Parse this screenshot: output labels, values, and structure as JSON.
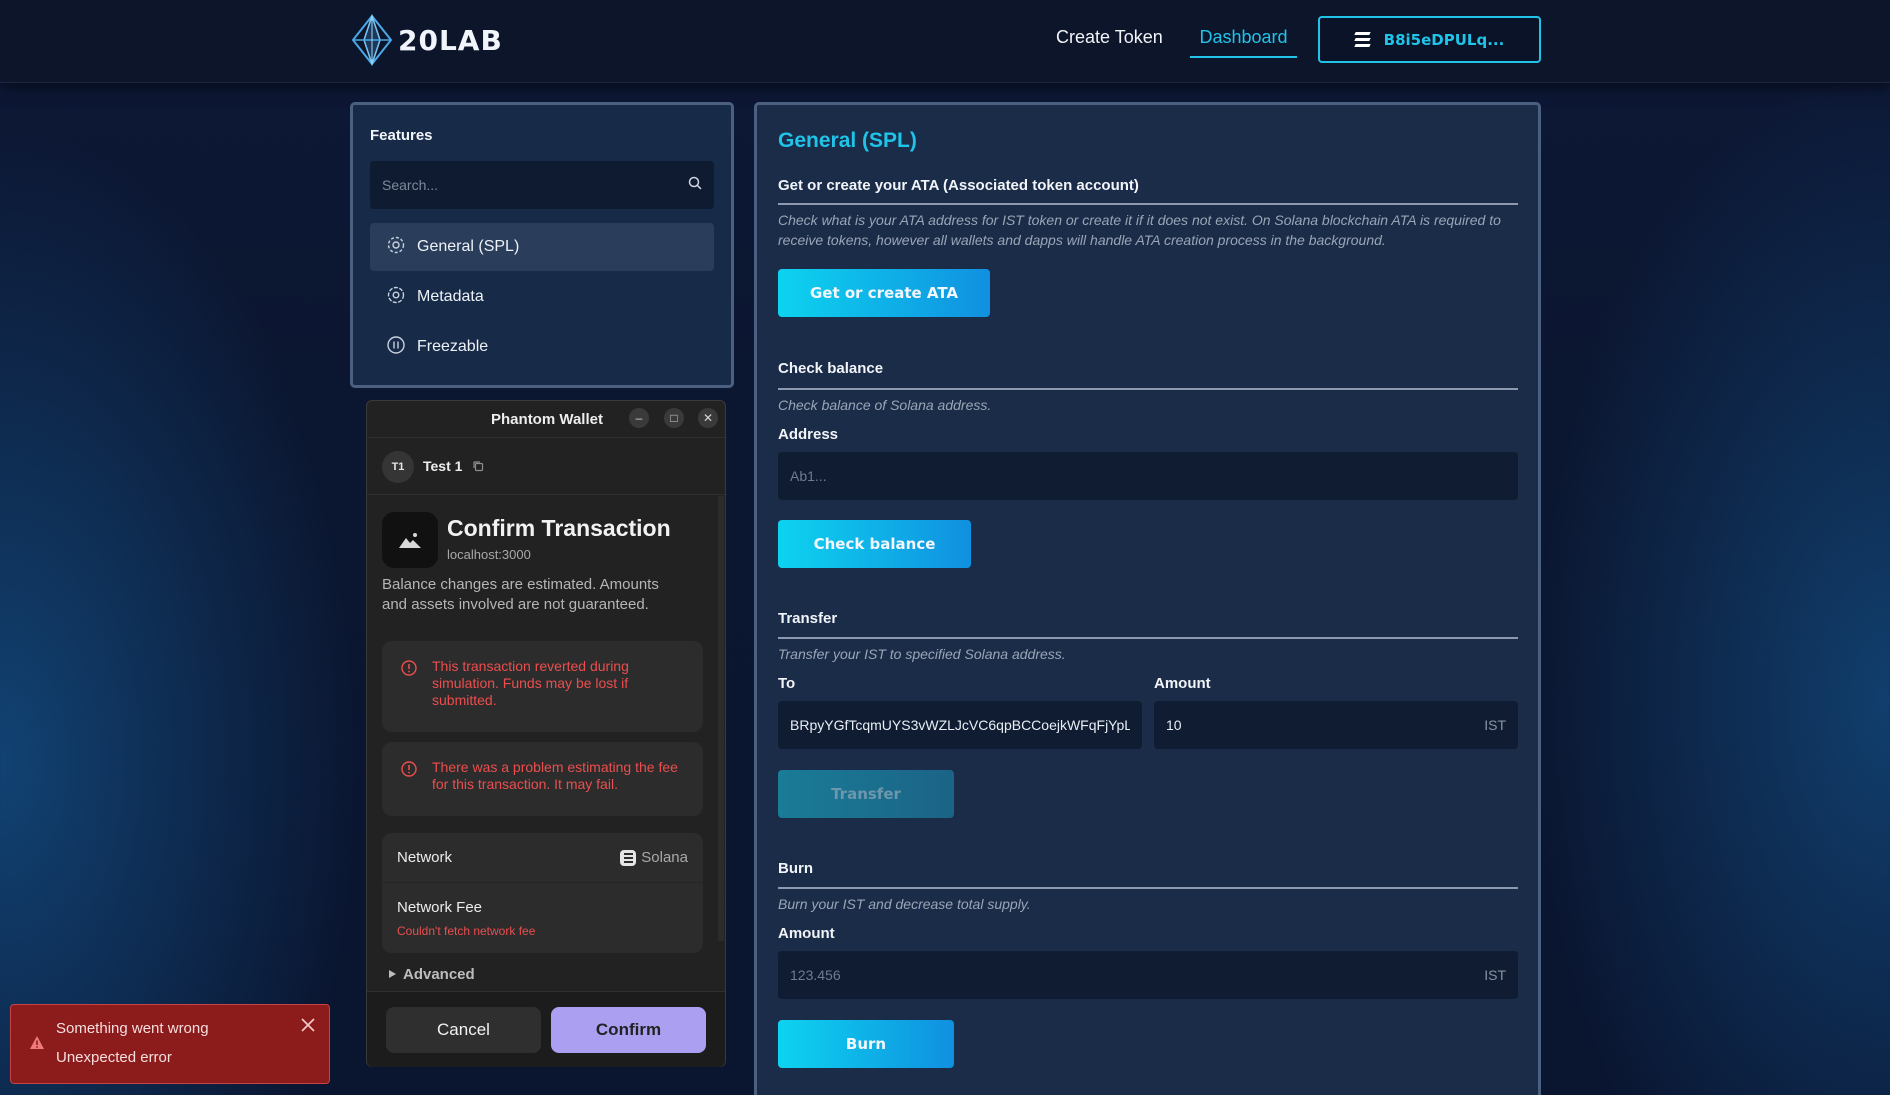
{
  "header": {
    "brand": "20LAB",
    "nav": {
      "create_token": "Create Token",
      "dashboard": "Dashboard"
    },
    "wallet_address": "B8i5eDPULq..."
  },
  "features": {
    "title": "Features",
    "search_placeholder": "Search...",
    "items": [
      {
        "label": "General (SPL)",
        "icon": "gear-icon",
        "active": true
      },
      {
        "label": "Metadata",
        "icon": "badge-icon",
        "active": false
      },
      {
        "label": "Freezable",
        "icon": "pause-icon",
        "active": false
      }
    ]
  },
  "main": {
    "title": "General (SPL)",
    "ata": {
      "title": "Get or create your ATA (Associated token account)",
      "description": "Check what is your ATA address for IST token or create it if it does not exist. On Solana blockchain ATA is required to receive tokens, however all wallets and dapps will handle ATA creation process in the background.",
      "button": "Get or create ATA"
    },
    "balance": {
      "title": "Check balance",
      "description": "Check balance of Solana address.",
      "address_label": "Address",
      "address_placeholder": "Ab1...",
      "button": "Check balance"
    },
    "transfer": {
      "title": "Transfer",
      "description": "Transfer your IST to specified Solana address.",
      "to_label": "To",
      "to_value": "BRpyYGfTcqmUYS3vWZLJcVC6qpBCCoejkWFqFjYpL",
      "amount_label": "Amount",
      "amount_value": "10",
      "unit": "IST",
      "button": "Transfer"
    },
    "burn": {
      "title": "Burn",
      "description": "Burn your IST and decrease total supply.",
      "amount_label": "Amount",
      "amount_placeholder": "123.456",
      "unit": "IST",
      "button": "Burn"
    }
  },
  "phantom": {
    "window_title": "Phantom Wallet",
    "window_buttons": {
      "minimize": "–",
      "maximize": "□",
      "close": "✕"
    },
    "account_initials": "T1",
    "account_name": "Test 1",
    "confirm_title": "Confirm Transaction",
    "origin": "localhost:3000",
    "note": "Balance changes are estimated. Amounts and assets involved are not guaranteed.",
    "warnings": [
      "This transaction reverted during simulation. Funds may be lost if submitted.",
      "There was a problem estimating the fee for this transaction. It may fail."
    ],
    "network_label": "Network",
    "network_value": "Solana",
    "fee_label": "Network Fee",
    "fee_error": "Couldn't fetch network fee",
    "advanced_label": "Advanced",
    "cancel": "Cancel",
    "confirm": "Confirm"
  },
  "toast": {
    "title": "Something went wrong",
    "message": "Unexpected error"
  }
}
